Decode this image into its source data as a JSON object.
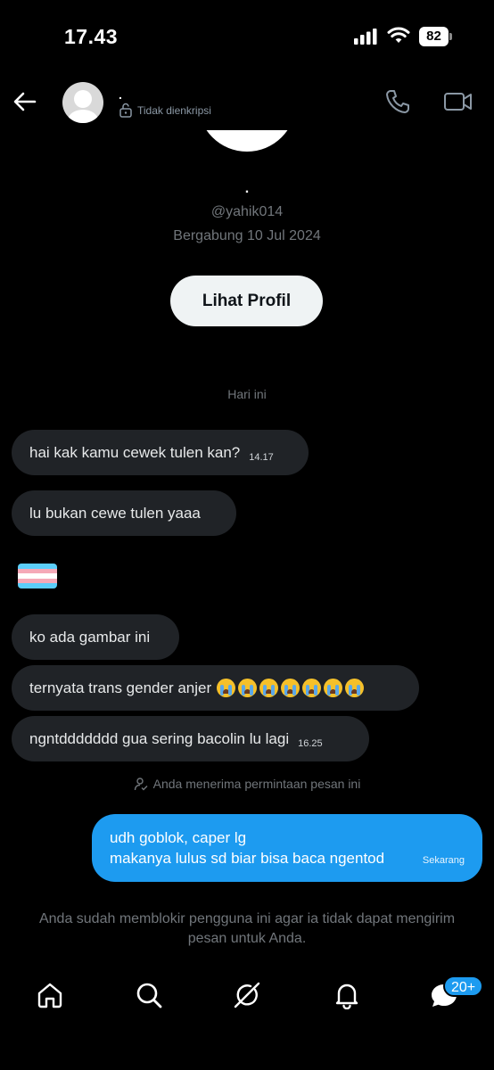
{
  "status_bar": {
    "time": "17.43",
    "battery": "82"
  },
  "header": {
    "name": ".",
    "encryption_status": "Tidak dienkripsi",
    "back_icon": "arrow-left-icon",
    "call_icon": "phone-icon",
    "video_icon": "video-camera-icon"
  },
  "profile": {
    "name": ".",
    "handle": "@yahik014",
    "joined": "Bergabung 10 Jul 2024",
    "view_profile_label": "Lihat Profil"
  },
  "chat": {
    "date_separator": "Hari ini",
    "messages": [
      {
        "text": "hai kak kamu cewek tulen kan?",
        "time": "14.17"
      },
      {
        "text": "lu bukan cewe tulen yaaa",
        "time": ""
      },
      {
        "image": "transgender-flag"
      },
      {
        "text": "ko ada gambar ini",
        "time": ""
      },
      {
        "text": "ternyata trans gender anjer",
        "emoji": "loudly-crying-face",
        "emoji_count": 7
      },
      {
        "text": "ngntddddddd gua sering bacolin lu lagi",
        "time": "16.25"
      }
    ],
    "accepted_notice": "Anda menerima permintaan pesan ini",
    "my_message": {
      "line1": "udh goblok, caper lg",
      "line2": "makanya lulus sd biar bisa baca ngentod",
      "time": "Sekarang"
    },
    "blocked_notice": "Anda sudah memblokir pengguna ini agar ia tidak dapat mengirim pesan untuk Anda."
  },
  "bottom_nav": {
    "items": [
      "home-icon",
      "search-icon",
      "grok-icon",
      "bell-icon",
      "messages-icon"
    ],
    "messages_badge": "20+"
  },
  "colors": {
    "background": "#000000",
    "bubble_received": "#202327",
    "bubble_sent": "#1d9bf0",
    "secondary_text": "#71767b",
    "flag": [
      "#5bcefa",
      "#f5a9b8",
      "#ffffff",
      "#f5a9b8",
      "#5bcefa"
    ]
  }
}
